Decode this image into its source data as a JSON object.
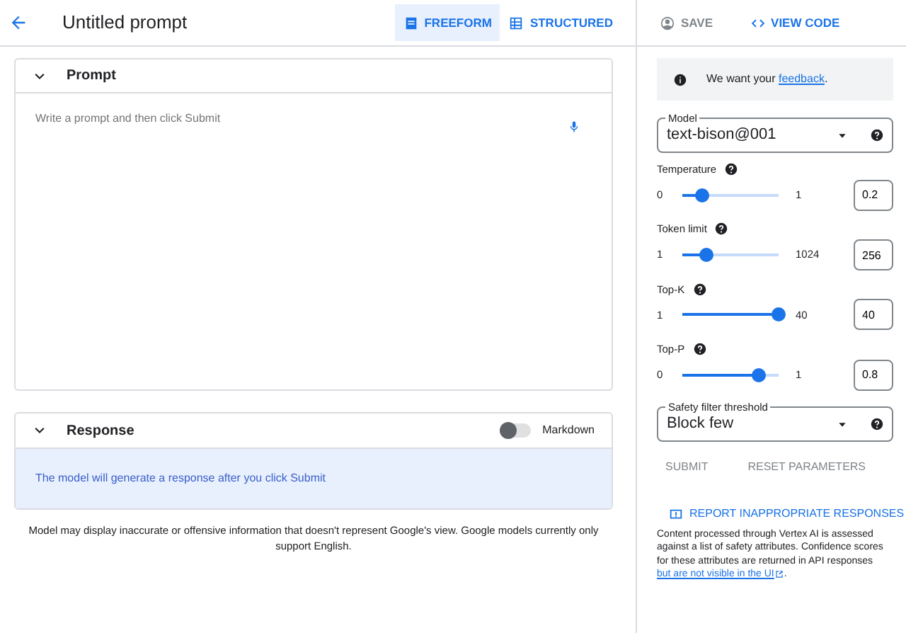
{
  "header": {
    "title": "Untitled prompt",
    "modes": [
      {
        "label": "FREEFORM",
        "kind": "doc",
        "selected": true
      },
      {
        "label": "STRUCTURED",
        "kind": "table",
        "selected": false
      }
    ],
    "actions": [
      {
        "label": "SAVE",
        "kind": "save",
        "disabled": true
      },
      {
        "label": "VIEW CODE",
        "kind": "code",
        "disabled": false
      }
    ]
  },
  "prompt": {
    "title": "Prompt",
    "expanded": true,
    "placeholder": "Write a prompt and then click Submit"
  },
  "response": {
    "title": "Response",
    "expanded": true,
    "markdown": {
      "label": "Markdown",
      "on": false
    },
    "message": "The model will generate a response after you click Submit"
  },
  "disclaimer": "Model may display inaccurate or offensive information that doesn't represent Google's view. Google models currently only support English.",
  "settings": {
    "notice": {
      "text": "We want your ",
      "link": "feedback",
      "end": "."
    },
    "model": {
      "label": "Model",
      "value": "text-bison@001"
    },
    "params": [
      {
        "label": "Temperature",
        "min": "0",
        "max": "1",
        "level": 0.2,
        "value": "0.2"
      },
      {
        "label": "Token limit",
        "min": "1",
        "max": "1024",
        "level": 0.25,
        "value": "256"
      },
      {
        "label": "Top-K",
        "min": "1",
        "max": "40",
        "level": 1,
        "value": "40"
      },
      {
        "label": "Top-P",
        "min": "0",
        "max": "1",
        "level": 0.8,
        "value": "0.8"
      }
    ],
    "safety": {
      "label": "Safety filter threshold",
      "value": "Block few"
    },
    "buttons": [
      {
        "label": "SUBMIT",
        "disabled": true
      },
      {
        "label": "RESET PARAMETERS",
        "disabled": true
      }
    ],
    "report": "REPORT INAPPROPRIATE RESPONSES",
    "info": {
      "text": "Content processed through Vertex AI is assessed against a list of safety attributes. Confidence scores for these attributes are returned in API responses ",
      "link": "but are not visible in the UI",
      "end": "."
    }
  }
}
